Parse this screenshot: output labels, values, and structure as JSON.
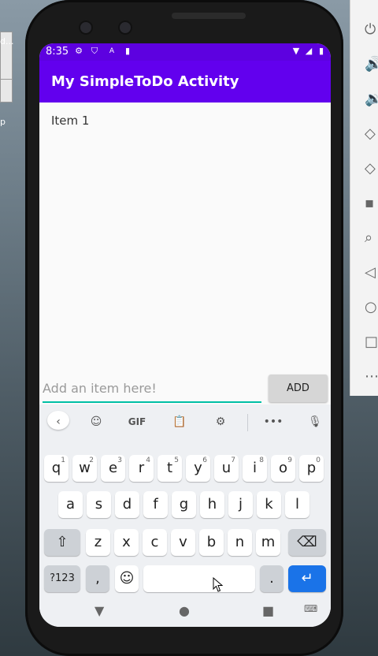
{
  "desktop": {
    "snippet_top": "d...",
    "snippet_bottom": "p"
  },
  "status_bar": {
    "time": "8:35",
    "icons": [
      "gear-icon",
      "shield-icon",
      "a-icon",
      "sd-card-icon",
      "wifi-icon",
      "signal-icon",
      "battery-icon"
    ]
  },
  "app_bar": {
    "title": "My SimpleToDo Activity"
  },
  "list": {
    "items": [
      "Item 1"
    ]
  },
  "input": {
    "placeholder": "Add an item here!",
    "value": ""
  },
  "add_button": {
    "label": "ADD"
  },
  "keyboard": {
    "toolbar": [
      "back",
      "sticker",
      "GIF",
      "clipboard",
      "settings",
      "more",
      "mic"
    ],
    "gif_label": "GIF",
    "more_label": "•••",
    "row1": [
      {
        "k": "q",
        "sup": "1"
      },
      {
        "k": "w",
        "sup": "2"
      },
      {
        "k": "e",
        "sup": "3"
      },
      {
        "k": "r",
        "sup": "4"
      },
      {
        "k": "t",
        "sup": "5"
      },
      {
        "k": "y",
        "sup": "6"
      },
      {
        "k": "u",
        "sup": "7"
      },
      {
        "k": "i",
        "sup": "8"
      },
      {
        "k": "o",
        "sup": "9"
      },
      {
        "k": "p",
        "sup": "0"
      }
    ],
    "row2": [
      "a",
      "s",
      "d",
      "f",
      "g",
      "h",
      "j",
      "k",
      "l"
    ],
    "row3": [
      "z",
      "x",
      "c",
      "v",
      "b",
      "n",
      "m"
    ],
    "symbols_label": "?123",
    "comma": ",",
    "period": ".",
    "emoji": "☺",
    "enter": "↵",
    "shift": "⇧",
    "backspace": "⌫"
  },
  "side_panel": {
    "icons": [
      "power-icon",
      "volume-up-icon",
      "volume-down-icon",
      "rotate-left-icon",
      "rotate-right-icon",
      "camera-icon",
      "zoom-icon",
      "back-icon",
      "home-icon",
      "overview-icon",
      "more-icon"
    ]
  },
  "nav_bar": {
    "back": "▼",
    "home": "●",
    "recents": "■"
  }
}
